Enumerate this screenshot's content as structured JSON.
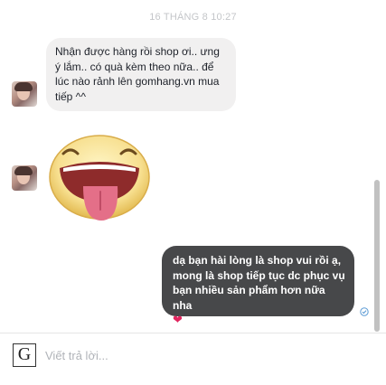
{
  "chat": {
    "timestamp": "16 THÁNG 8 10:27",
    "incoming_message": "Nhận được hàng rồi shop ơi.. ưng ý lắm.. có quà kèm theo nữa.. để lúc nào rảnh lên gomhang.vn mua tiếp ^^",
    "sticker_icon": "tongue-out-smiley-sticker",
    "outgoing_message": "dạ bạn hài lòng là shop vui rồi ạ, mong là shop tiếp tục dc phục vụ bạn nhiều sản phẩm hơn nữa nha",
    "outgoing_emoji": "❤",
    "seen_icon": "check-circle-icon"
  },
  "composer": {
    "logo_letter": "G",
    "placeholder": "Viết trả lời..."
  },
  "colors": {
    "incoming_bubble": "#f1f0f0",
    "outgoing_bubble": "#47484a",
    "heart": "#e0245e",
    "seen": "#5b9bd5"
  }
}
